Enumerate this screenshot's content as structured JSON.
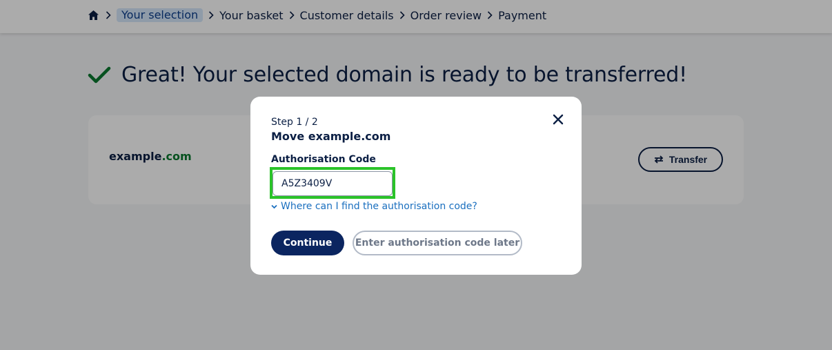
{
  "breadcrumb": {
    "home_icon": "home-icon",
    "items": [
      {
        "label": "Your selection",
        "active": true
      },
      {
        "label": "Your basket",
        "active": false
      },
      {
        "label": "Customer details",
        "active": false
      },
      {
        "label": "Order review",
        "active": false
      },
      {
        "label": "Payment",
        "active": false
      }
    ]
  },
  "headline": {
    "icon": "check-icon",
    "text": "Great! Your selected domain is ready to be transferred!"
  },
  "domain_card": {
    "domain_base": "example",
    "domain_tld": ".com",
    "transfer_label": "Transfer",
    "transfer_icon": "swap-arrows-icon"
  },
  "modal": {
    "step": "Step 1 / 2",
    "title": "Move example.com",
    "field_label": "Authorisation Code",
    "auth_code_value": "A5Z3409V",
    "help_link": "Where can I find the authorisation code?",
    "continue_label": "Continue",
    "later_label": "Enter authorisation code later",
    "close_icon": "close-icon"
  },
  "colors": {
    "primary": "#0b2560",
    "text": "#0b1f44",
    "tld_green": "#0a7a2f",
    "link": "#1a6fbf",
    "highlight": "#2bc329",
    "breadcrumb_active_bg": "#d6e7fb"
  }
}
